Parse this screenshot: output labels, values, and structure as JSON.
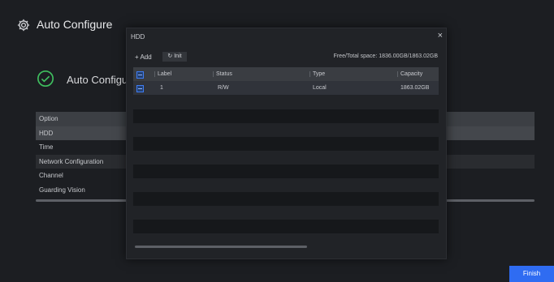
{
  "header": {
    "title": "Auto Configure",
    "icon": "gear-icon"
  },
  "status": {
    "text": "Auto Configura",
    "icon": "check-circle-icon",
    "color": "#3fbf5f"
  },
  "options": {
    "rows": [
      {
        "label": "Option"
      },
      {
        "label": "HDD"
      },
      {
        "label": "Time"
      },
      {
        "label": "Network Configuration"
      },
      {
        "label": "Channel"
      },
      {
        "label": "Guarding Vision"
      }
    ]
  },
  "footer": {
    "finish_label": "Finish",
    "accent": "#2f6cf2"
  },
  "modal": {
    "title": "HDD",
    "close_label": "×",
    "add_label": "+ Add",
    "edit_label": "↻ Init",
    "space_info": "Free/Total space: 1836.00GB/1863.02GB",
    "columns": [
      "Label",
      "Status",
      "Type",
      "Capacity"
    ],
    "rows": [
      {
        "label": "1",
        "status": "R/W",
        "type": "Local",
        "capacity": "1863.02GB"
      }
    ]
  }
}
